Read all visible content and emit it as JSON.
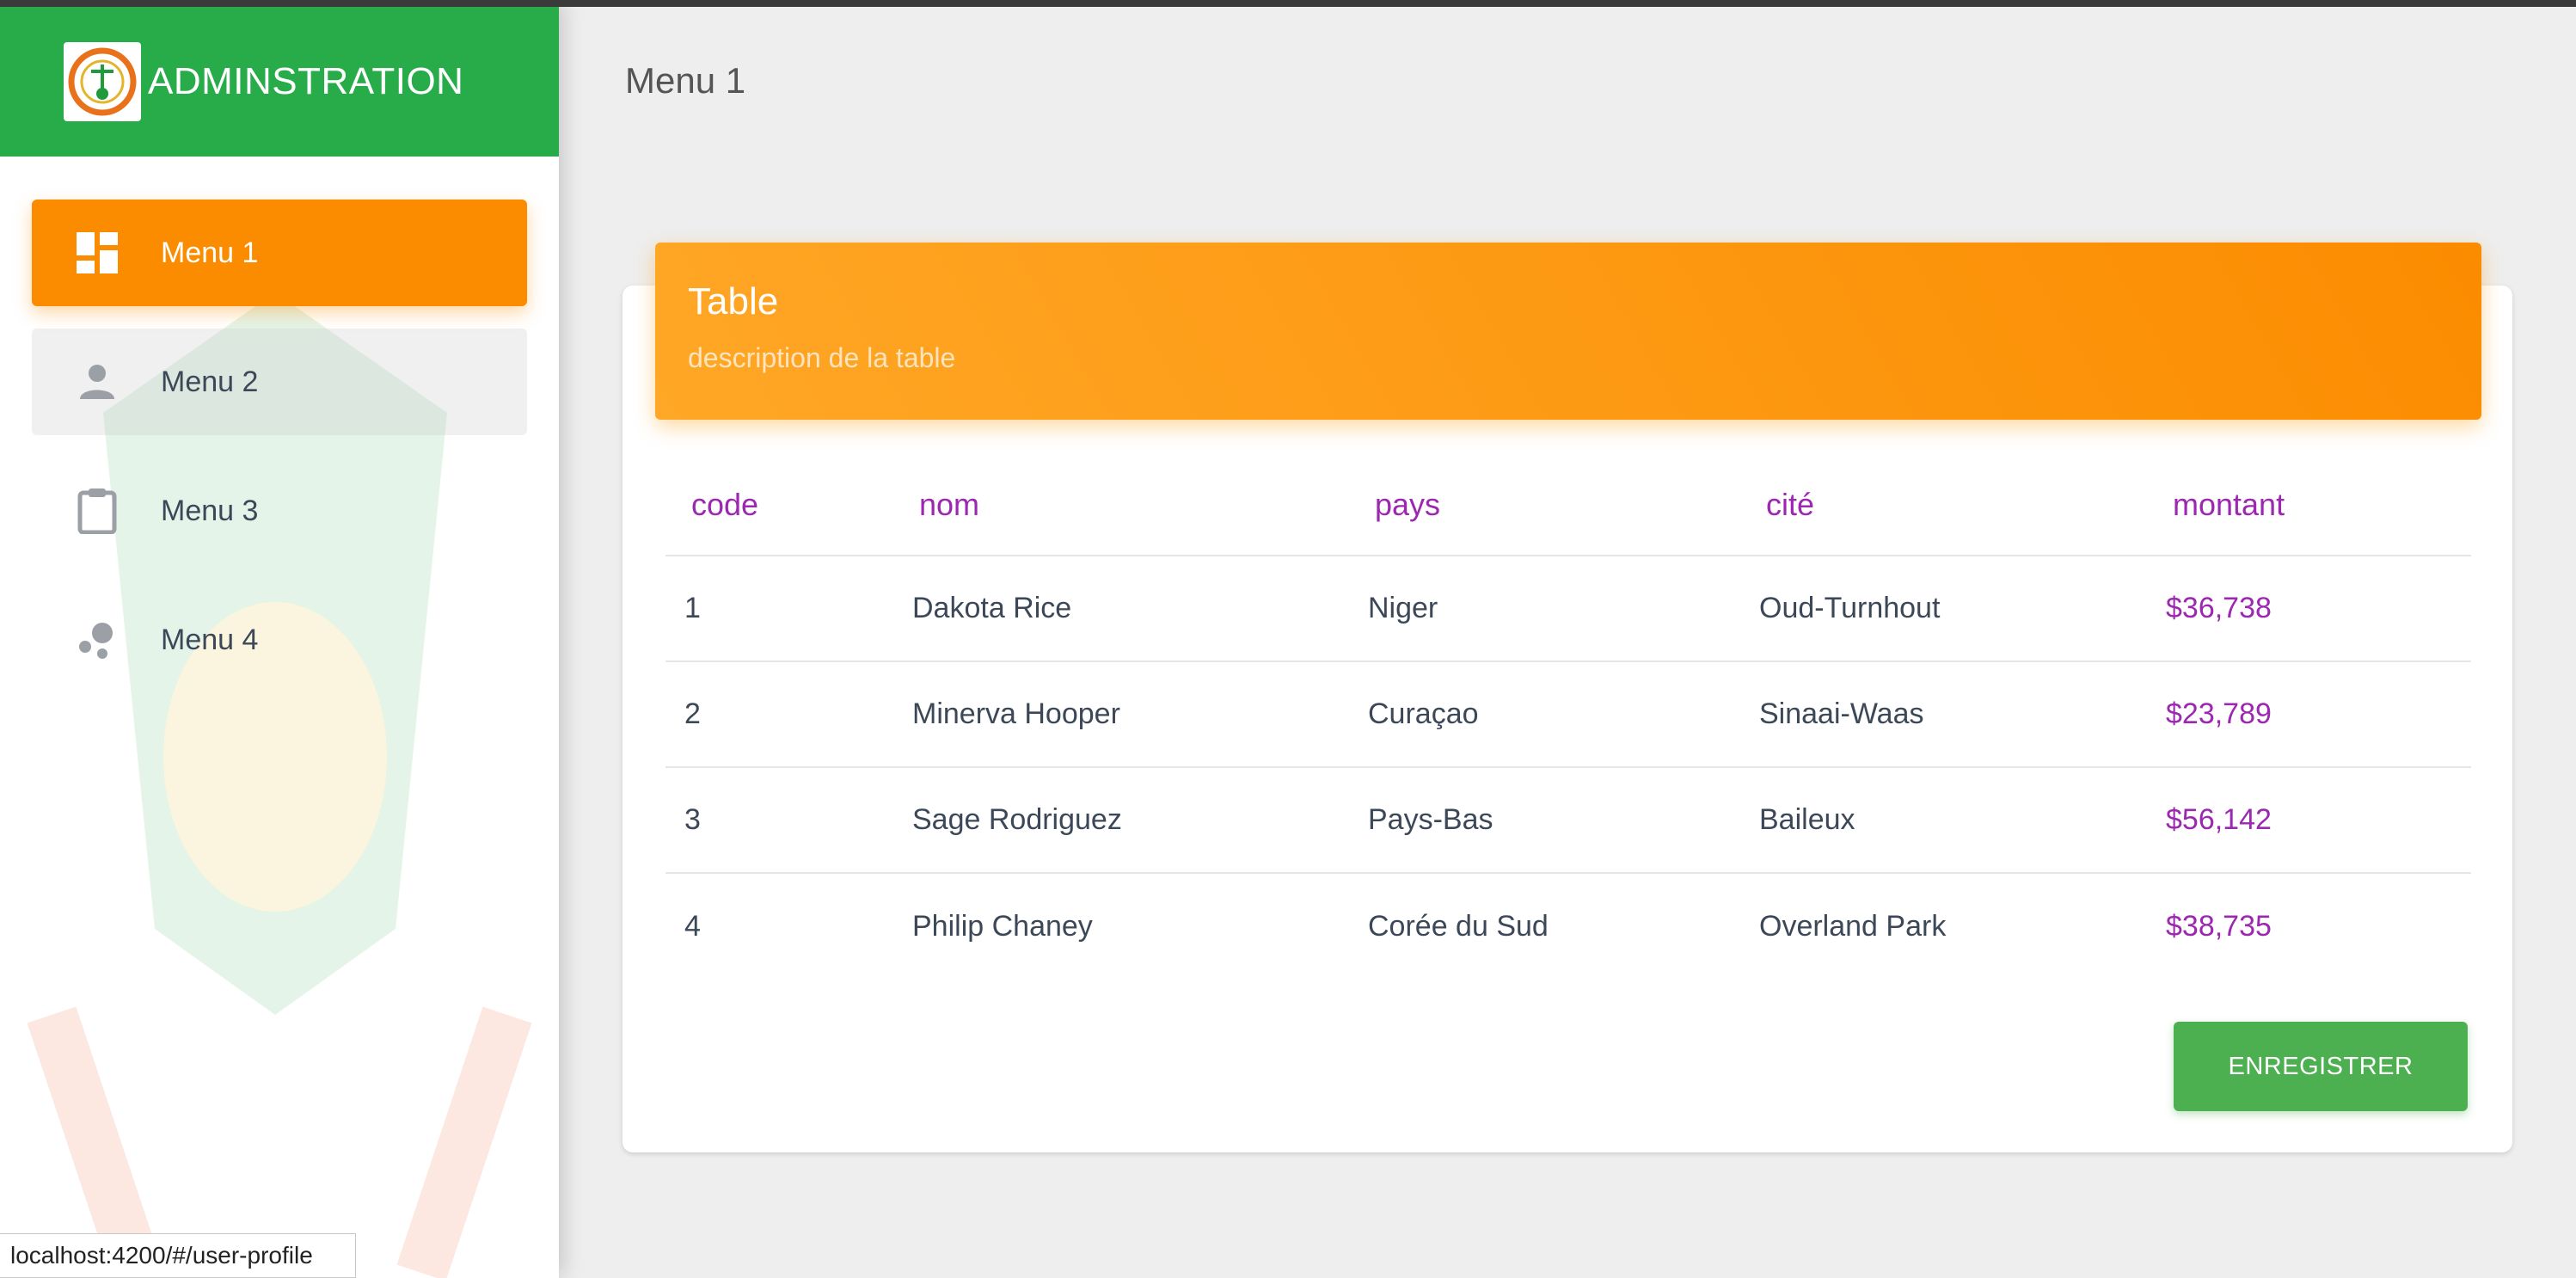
{
  "brand": {
    "title": "ADMINSTRATION",
    "logo_icon": "emblem-icon"
  },
  "sidebar": {
    "items": [
      {
        "label": "Menu 1",
        "icon": "dashboard-icon",
        "active": true
      },
      {
        "label": "Menu 2",
        "icon": "person-icon"
      },
      {
        "label": "Menu 3",
        "icon": "clipboard-icon"
      },
      {
        "label": "Menu 4",
        "icon": "bubbles-icon"
      }
    ]
  },
  "page": {
    "title": "Menu 1"
  },
  "card": {
    "title": "Table",
    "description": "description de la table",
    "columns": [
      "code",
      "nom",
      "pays",
      "cité",
      "montant"
    ],
    "rows": [
      [
        "1",
        "Dakota Rice",
        "Niger",
        "Oud-Turnhout",
        "$36,738"
      ],
      [
        "2",
        "Minerva Hooper",
        "Curaçao",
        "Sinaai-Waas",
        "$23,789"
      ],
      [
        "3",
        "Sage Rodriguez",
        "Pays-Bas",
        "Baileux",
        "$56,142"
      ],
      [
        "4",
        "Philip Chaney",
        "Corée du Sud",
        "Overland Park",
        "$38,735"
      ]
    ],
    "save_label": "ENREGISTRER"
  },
  "status": {
    "url": "localhost:4200/#/user-profile"
  },
  "colors": {
    "brand_green": "#28ab49",
    "accent_orange": "#fb8c00",
    "header_purple": "#9c27b0",
    "button_green": "#4caf50"
  }
}
